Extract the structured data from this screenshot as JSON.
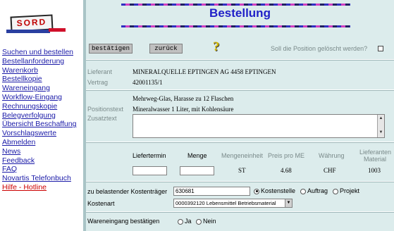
{
  "sidebar": {
    "logo_text": "SORD",
    "items": [
      {
        "label": "Suchen und bestellen"
      },
      {
        "label": "Bestellanforderung"
      },
      {
        "label": "Warenkorb"
      },
      {
        "label": "Bestellkopie"
      },
      {
        "label": "Wareneingang"
      },
      {
        "label": "Workflow-Eingang"
      },
      {
        "label": "Rechnungskopie"
      },
      {
        "label": "Belegverfolgung"
      },
      {
        "label": "Übersicht Beschaffung"
      },
      {
        "label": "Vorschlagswerte"
      },
      {
        "label": "Abmelden"
      },
      {
        "label": "News"
      },
      {
        "label": "Feedback"
      },
      {
        "label": "FAQ"
      },
      {
        "label": "Novartis Telefonbuch"
      },
      {
        "label": "Hilfe - Hotline"
      }
    ]
  },
  "header": {
    "title": "Bestellung"
  },
  "toolbar": {
    "confirm_label": "bestätigen",
    "back_label": "zurück",
    "delete_question": "Soll die Position gelöscht werden?"
  },
  "supplier": {
    "lieferant_label": "Lieferant",
    "lieferant_value": "MINERALQUELLE EPTINGEN AG 4458 EPTINGEN",
    "vertrag_label": "Vertrag",
    "vertrag_value": "42001135/1"
  },
  "position": {
    "line1": "Mehrweg-Glas, Harasse zu 12 Flaschen",
    "positionstext_label": "Positionstext",
    "positionstext_value": "Mineralwasser 1 Liter, mit Kohlensäure",
    "zusatztext_label": "Zusatztext"
  },
  "order_table": {
    "liefertermin_label": "Liefertermin",
    "menge_label": "Menge",
    "mengeneinheit_label": "Mengeneinheit",
    "preis_label": "Preis pro ME",
    "waehrung_label": "Währung",
    "lieferanten_label_1": "Lieferanten",
    "lieferanten_label_2": "Material",
    "mengeneinheit_value": "ST",
    "preis_value": "4.68",
    "waehrung_value": "CHF",
    "material_value": "1003"
  },
  "account": {
    "kostentraeger_label": "zu belastender Kostenträger",
    "kostentraeger_value": "630681",
    "radio_kostenstelle": "Kostenstelle",
    "radio_auftrag": "Auftrag",
    "radio_projekt": "Projekt",
    "kostenart_label": "Kostenart",
    "kostenart_value": "0000392120 Lebensmittel Betriebsmaterial"
  },
  "receipt": {
    "label": "Wareneingang bestätigen",
    "ja": "Ja",
    "nein": "Nein"
  }
}
